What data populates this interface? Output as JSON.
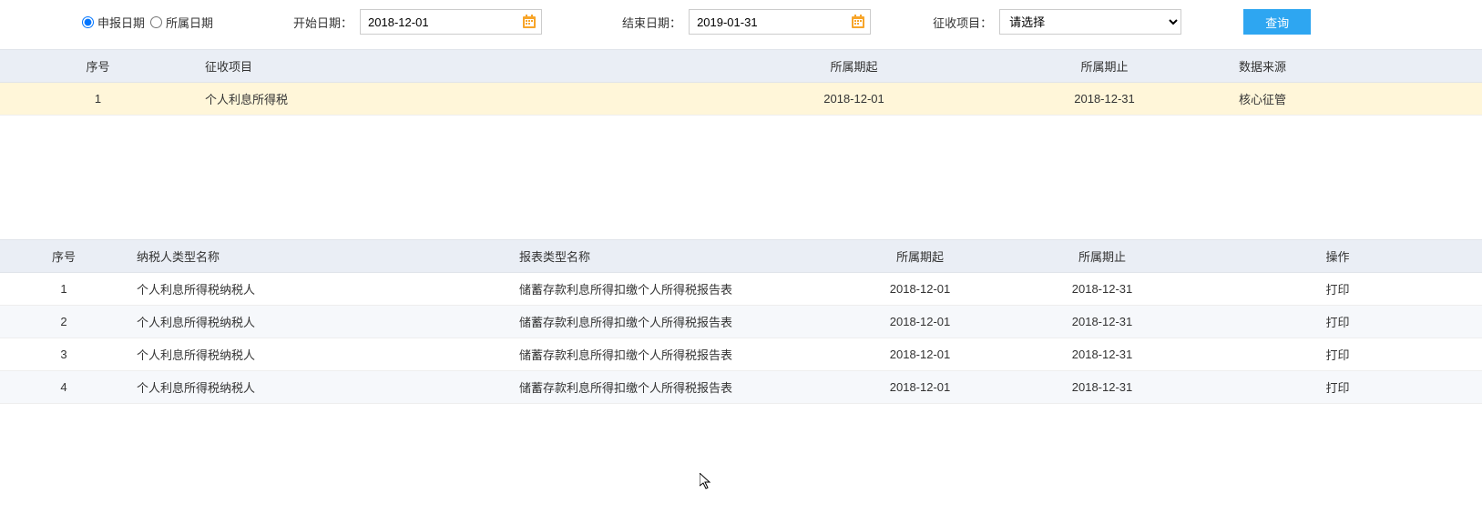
{
  "filter": {
    "radio_declare": "申报日期",
    "radio_belong": "所属日期",
    "start_label": "开始日期：",
    "start_value": "2018-12-01",
    "end_label": "结束日期：",
    "end_value": "2019-01-31",
    "project_label": "征收项目：",
    "project_placeholder": "请选择",
    "query_btn": "查询"
  },
  "table1": {
    "headers": {
      "seq": "序号",
      "item": "征收项目",
      "start": "所属期起",
      "end": "所属期止",
      "source": "数据来源"
    },
    "rows": [
      {
        "seq": "1",
        "item": "个人利息所得税",
        "start": "2018-12-01",
        "end": "2018-12-31",
        "source": "核心征管"
      }
    ]
  },
  "table2": {
    "headers": {
      "seq": "序号",
      "type": "纳税人类型名称",
      "report": "报表类型名称",
      "start": "所属期起",
      "end": "所属期止",
      "op": "操作"
    },
    "rows": [
      {
        "seq": "1",
        "type": "个人利息所得税纳税人",
        "report": "储蓄存款利息所得扣缴个人所得税报告表",
        "start": "2018-12-01",
        "end": "2018-12-31",
        "op": "打印"
      },
      {
        "seq": "2",
        "type": "个人利息所得税纳税人",
        "report": "储蓄存款利息所得扣缴个人所得税报告表",
        "start": "2018-12-01",
        "end": "2018-12-31",
        "op": "打印"
      },
      {
        "seq": "3",
        "type": "个人利息所得税纳税人",
        "report": "储蓄存款利息所得扣缴个人所得税报告表",
        "start": "2018-12-01",
        "end": "2018-12-31",
        "op": "打印"
      },
      {
        "seq": "4",
        "type": "个人利息所得税纳税人",
        "report": "储蓄存款利息所得扣缴个人所得税报告表",
        "start": "2018-12-01",
        "end": "2018-12-31",
        "op": "打印"
      }
    ]
  }
}
